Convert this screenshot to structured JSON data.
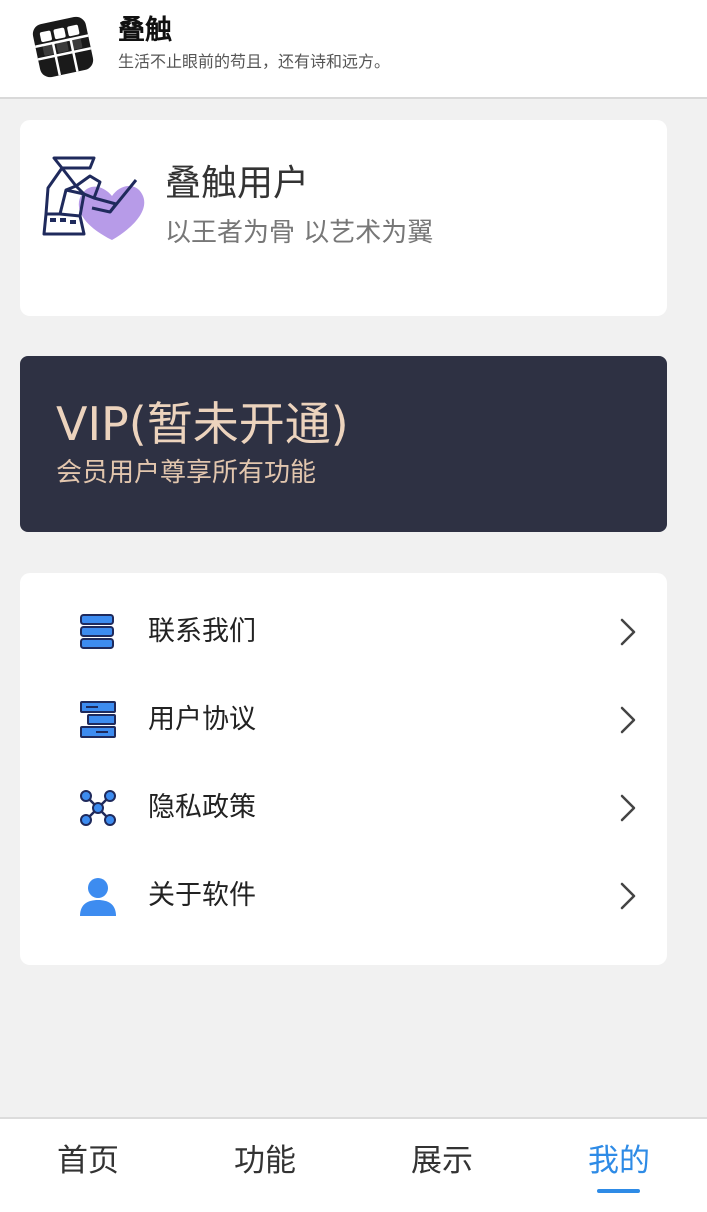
{
  "header": {
    "title": "叠触",
    "subtitle": "生活不止眼前的苟且，还有诗和远方。",
    "logo_icon": "rubiks-cube-icon"
  },
  "profile": {
    "name": "叠触用户",
    "motto": "以王者为骨 以艺术为翼",
    "avatar_icon": "knight-heart-avatar"
  },
  "vip": {
    "title": "VIP(暂未开通)",
    "subtitle": "会员用户尊享所有功能",
    "background": "#2e3143",
    "text_color": "#ecd3bd"
  },
  "menu": {
    "items": [
      {
        "label": "联系我们",
        "icon": "contact-icon"
      },
      {
        "label": "用户协议",
        "icon": "agreement-icon"
      },
      {
        "label": "隐私政策",
        "icon": "privacy-network-icon"
      },
      {
        "label": "关于软件",
        "icon": "user-about-icon"
      }
    ]
  },
  "tabs": [
    {
      "label": "首页",
      "active": false
    },
    {
      "label": "功能",
      "active": false
    },
    {
      "label": "展示",
      "active": false
    },
    {
      "label": "我的",
      "active": true
    }
  ],
  "colors": {
    "accent": "#2e8be6",
    "icon_blue": "#3d8cf0",
    "background": "#f1f1f1"
  }
}
